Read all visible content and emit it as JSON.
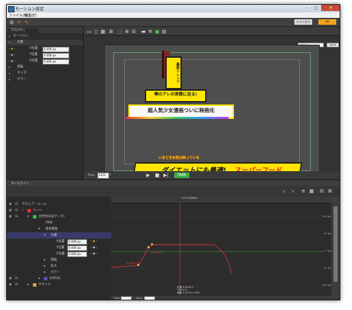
{
  "window": {
    "title": "モーション設定"
  },
  "menu": {
    "file": "ファイル(F)",
    "edit": "編集(E)"
  },
  "toolbar": {
    "cancel_label": "キャンセル",
    "ok_label": "OK"
  },
  "properties": {
    "tab_label": "プロパティ",
    "rows": [
      {
        "label": "モーション"
      },
      {
        "label": "位置"
      },
      {
        "label": "X位置",
        "value": "0.000 px"
      },
      {
        "label": "Y位置",
        "value": "0.000 px"
      },
      {
        "label": "Z位置",
        "value": "0.000 px"
      },
      {
        "label": "回転"
      },
      {
        "label": "サイズ"
      },
      {
        "label": "カラー"
      }
    ]
  },
  "preview": {
    "dropdown_front": "フロント",
    "dropdown_zoom": "100%",
    "frame_value": "1121",
    "frame_unit": "f",
    "time_label": "Time",
    "take_label": "TAKE",
    "texts": {
      "t1": "最新トレンド",
      "t2": "噂のアレの実態に迫る!",
      "t3": "超人気少女漫画ついに映画化",
      "t4": "いまどき女性は知っている",
      "t5a": "ダイエットにも最適!",
      "t5b": "スーパーフード"
    }
  },
  "timeline": {
    "tab_label": "タイムライン",
    "tree": [
      {
        "label": "テロップ・ルーム"
      },
      {
        "label": "シーン"
      },
      {
        "label": "文字列(6日データ)"
      },
      {
        "label": "TIME"
      },
      {
        "label": "基本属性"
      },
      {
        "label": "位置"
      },
      {
        "label": "X位置",
        "value": "0.000 px"
      },
      {
        "label": "Y位置",
        "value": "0.000 px"
      },
      {
        "label": "Z位置",
        "value": "0.000 px"
      },
      {
        "label": "回転"
      },
      {
        "label": "拡大"
      },
      {
        "label": "カラー"
      },
      {
        "label": "文字(D)"
      },
      {
        "label": "サウンド"
      }
    ],
    "ruler_marker": "1:01 (40/8px)",
    "graph_labels": {
      "g1": "0.062/0.12",
      "g2": "0.062/0.014"
    },
    "footer_left_label": "Time",
    "footer_value_label": "Value",
    "info_lines": [
      "位置  X:0/Y:0.0",
      "Y:0/Y:0.0",
      "時間 1:1/Y:0/1.1001"
    ],
    "axis_right": [
      "100 fps",
      "50 fps",
      "0 fps",
      "-50 fps",
      "-100 fps"
    ]
  }
}
